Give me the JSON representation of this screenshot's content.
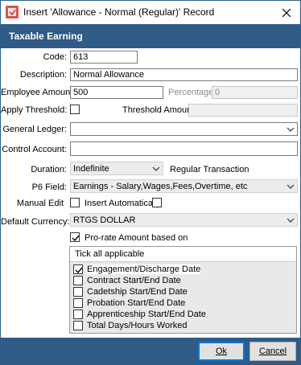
{
  "window": {
    "title": "Insert 'Allowance - Normal (Regular)' Record",
    "icon": "app-icon",
    "close_icon": "close-icon"
  },
  "header": {
    "title": "Taxable Earning"
  },
  "form": {
    "code_label": "Code:",
    "code_value": "613",
    "description_label": "Description:",
    "description_value": "Normal Allowance",
    "employee_amount_label": "Employee Amount:",
    "employee_amount_value": "500",
    "percentage_label": "Percentage:",
    "percentage_value": "0",
    "apply_threshold_label": "Apply Threshold:",
    "apply_threshold_checked": false,
    "threshold_amount_label": "Threshold Amount:",
    "threshold_amount_value": "",
    "general_ledger_label": "General Ledger:",
    "general_ledger_value": "",
    "control_account_label": "Control Account:",
    "control_account_value": "",
    "duration_label": "Duration:",
    "duration_value": "Indefinite",
    "regular_transaction_label": "Regular Transaction",
    "p6_field_label": "P6 Field:",
    "p6_field_value": "Earnings - Salary,Wages,Fees,Overtime, etc",
    "manual_edit_label": "Manual Edit",
    "manual_edit_checked": false,
    "insert_automatically_label": "Insert Automatically",
    "insert_automatically_checked": false,
    "default_currency_label": "Default Currency:",
    "default_currency_value": "RTGS DOLLAR",
    "prorate_label": "Pro-rate Amount based on",
    "prorate_checked": true
  },
  "prorate_list": {
    "header": "Tick all applicable",
    "items": [
      {
        "label": "Engagement/Discharge Date",
        "checked": true
      },
      {
        "label": "Contract Start/End Date",
        "checked": false
      },
      {
        "label": "Cadetship Start/End Date",
        "checked": false
      },
      {
        "label": "Probation Start/End Date",
        "checked": false
      },
      {
        "label": "Apprenticeship Start/End Date",
        "checked": false
      },
      {
        "label": "Total Days/Hours Worked",
        "checked": false
      }
    ]
  },
  "buttons": {
    "ok_label": "Ok",
    "cancel_label": "Cancel"
  },
  "colors": {
    "accent": "#2f5b86",
    "focus": "#0078d7"
  }
}
